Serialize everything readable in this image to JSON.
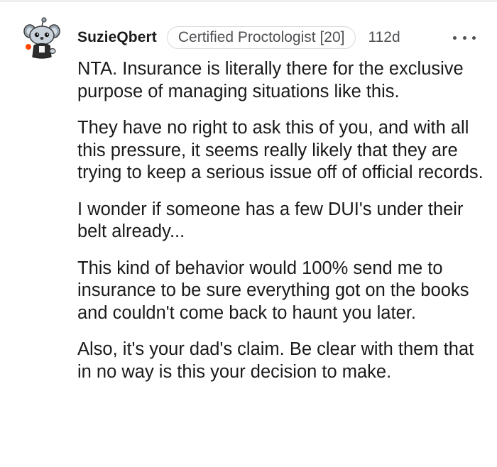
{
  "comment": {
    "username": "SuzieQbert",
    "flair": "Certified Proctologist [20]",
    "age": "112d",
    "more_icon": "ellipsis-icon",
    "avatar_icon": "snoo-avatar-icon",
    "paragraphs": [
      "NTA. Insurance is literally there for the exclusive purpose of managing situations like this.",
      "They have no right to ask this of you, and with all this pressure, it seems really likely that they are trying to keep a serious issue off of official records.",
      "I wonder if someone has a few DUI's under their belt already...",
      "This kind of behavior would 100% send me to insurance to be sure everything got on the books and couldn't come back to haunt you later.",
      "Also, it's your dad's claim. Be clear with them that in no way is this your decision to make."
    ]
  },
  "colors": {
    "text": "#1a1a1b",
    "meta": "#4f5154",
    "flair_border": "#d7dadc",
    "avatar_accent": "#ff4500",
    "avatar_body": "#5f99b8"
  }
}
